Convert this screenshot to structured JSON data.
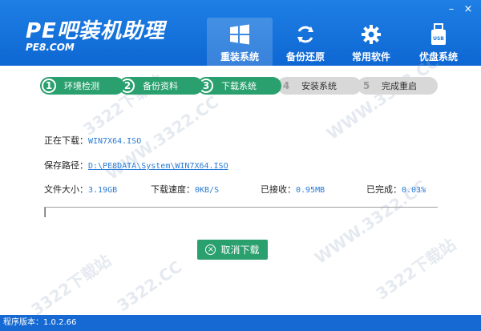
{
  "app": {
    "logo": "PE吧装机助理",
    "logo_sub": "PE8.COM"
  },
  "window_controls": {
    "minimize": "–",
    "close": "×"
  },
  "nav": [
    {
      "label": "重装系统",
      "icon": "windows-icon",
      "active": true
    },
    {
      "label": "备份还原",
      "icon": "refresh-icon",
      "active": false
    },
    {
      "label": "常用软件",
      "icon": "gear-icon",
      "active": false
    },
    {
      "label": "优盘系统",
      "icon": "usb-icon",
      "active": false
    }
  ],
  "steps": [
    {
      "num": "1",
      "label": "环境检测",
      "state": "done"
    },
    {
      "num": "2",
      "label": "备份资料",
      "state": "done"
    },
    {
      "num": "3",
      "label": "下载系统",
      "state": "done"
    },
    {
      "num": "4",
      "label": "安装系统",
      "state": "todo"
    },
    {
      "num": "5",
      "label": "完成重启",
      "state": "todo"
    }
  ],
  "download": {
    "downloading_label": "正在下载：",
    "downloading_value": "WIN7X64.ISO",
    "save_path_label": "保存路径：",
    "save_path_value": "D:\\PE8DATA\\System\\WIN7X64.ISO",
    "file_size_label": "文件大小：",
    "file_size_value": "3.19GB",
    "speed_label": "下载速度：",
    "speed_value": "0KB/S",
    "received_label": "已接收：",
    "received_value": "0.95MB",
    "completed_label": "已完成：",
    "completed_value": "0.03%",
    "progress": 0.0003
  },
  "cancel_button": "取消下载",
  "statusbar": {
    "version": "程序版本：1.0.2.66"
  },
  "watermarks": [
    "3322下载站",
    "WWW.3322.CC",
    "3322.CC"
  ],
  "colors": {
    "primary": "#1669d2",
    "accent": "#2aa06e",
    "link": "#2a7bd5"
  }
}
